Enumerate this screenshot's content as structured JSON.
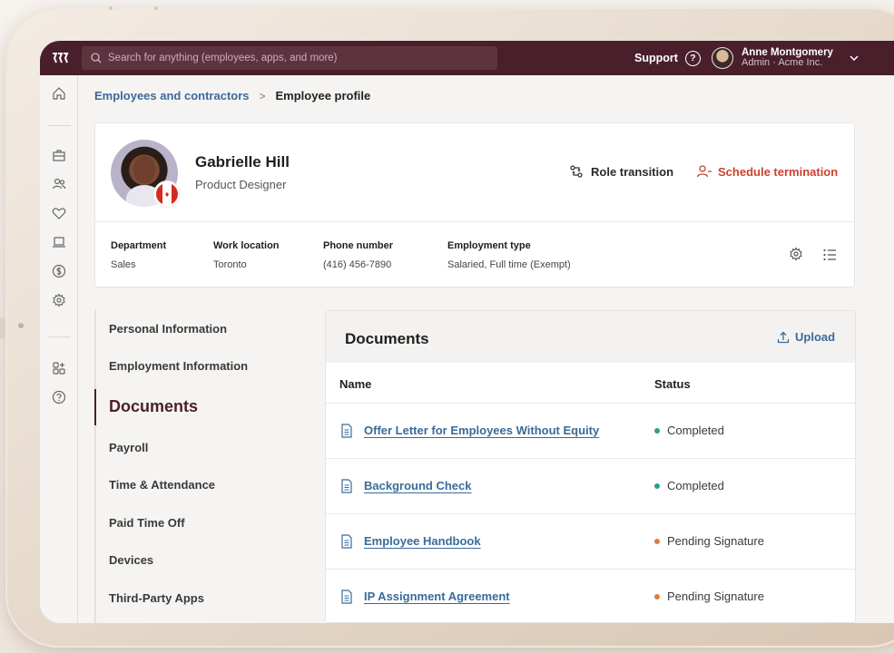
{
  "topbar": {
    "search_placeholder": "Search for anything (employees, apps, and more)",
    "support_label": "Support",
    "user_name": "Anne Montgomery",
    "user_role": "Admin · Acme Inc."
  },
  "breadcrumb": {
    "parent": "Employees and contractors",
    "separator": ">",
    "current": "Employee profile"
  },
  "profile": {
    "name": "Gabrielle Hill",
    "title": "Product Designer",
    "actions": {
      "role_transition": "Role transition",
      "schedule_termination": "Schedule termination"
    },
    "fields": [
      {
        "label": "Department",
        "value": "Sales"
      },
      {
        "label": "Work location",
        "value": "Toronto"
      },
      {
        "label": "Phone number",
        "value": "(416) 456-7890"
      },
      {
        "label": "Employment type",
        "value": "Salaried, Full time (Exempt)"
      }
    ]
  },
  "section_nav": {
    "items": [
      {
        "label": "Personal Information"
      },
      {
        "label": "Employment Information"
      },
      {
        "label": "Documents",
        "active": true
      },
      {
        "label": "Payroll"
      },
      {
        "label": "Time & Attendance"
      },
      {
        "label": "Paid Time Off"
      },
      {
        "label": "Devices"
      },
      {
        "label": "Third-Party Apps"
      }
    ]
  },
  "documents": {
    "title": "Documents",
    "upload_label": "Upload",
    "columns": {
      "name": "Name",
      "status": "Status"
    },
    "rows": [
      {
        "name": "Offer Letter for Employees Without Equity",
        "status": "Completed",
        "status_color": "#2a9d8f"
      },
      {
        "name": "Background Check",
        "status": "Completed",
        "status_color": "#2a9d8f"
      },
      {
        "name": "Employee Handbook",
        "status": "Pending Signature",
        "status_color": "#e07b39"
      },
      {
        "name": "IP Assignment Agreement",
        "status": "Pending Signature",
        "status_color": "#e07b39"
      }
    ]
  },
  "colors": {
    "brand": "#4a1f2c",
    "link": "#3a6a9a",
    "danger": "#c9432f"
  },
  "icons": {
    "rail": [
      "home-icon",
      "briefcase-icon",
      "people-icon",
      "heart-icon",
      "laptop-icon",
      "dollar-icon",
      "gear-icon",
      "apps-icon",
      "help-icon"
    ]
  }
}
